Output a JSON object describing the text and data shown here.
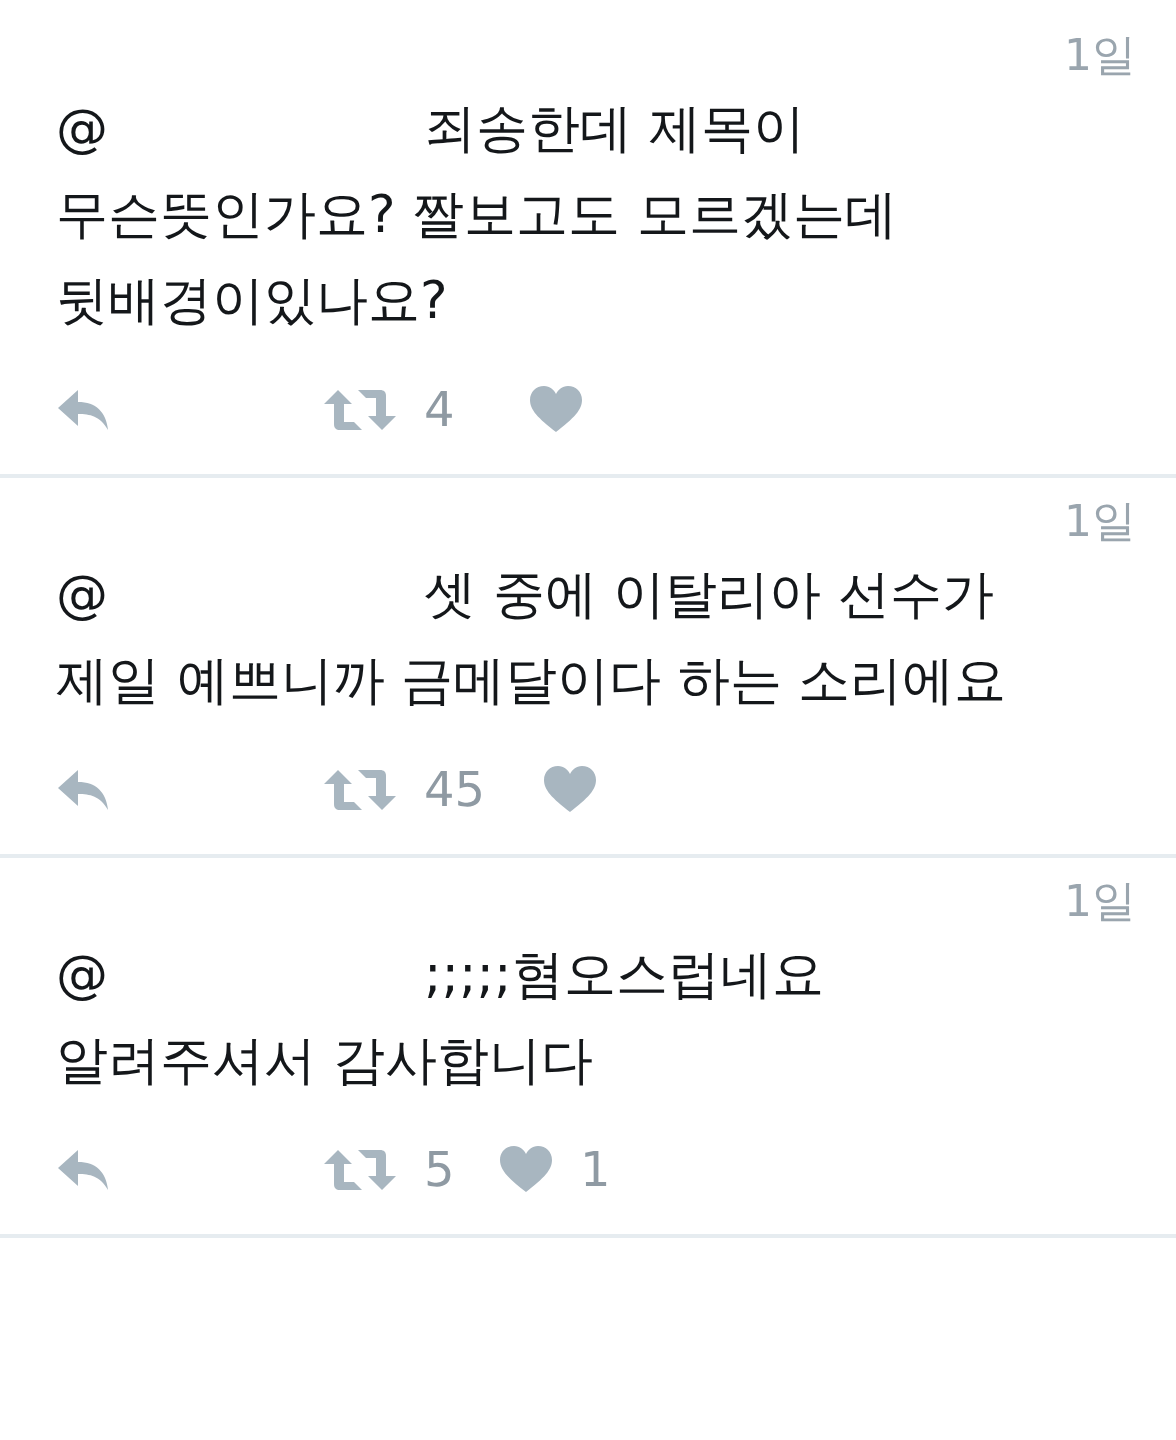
{
  "tweets": [
    {
      "time": "1일",
      "mention": "@",
      "lines": [
        "죄송한데 제목이",
        "무슨뜻인가요? 짤보고도 모르겠는데",
        "뒷배경이있나요?"
      ],
      "retweets": "4"
    },
    {
      "time": "1일",
      "mention": "@",
      "lines": [
        "셋 중에 이탈리아 선수가",
        "제일 예쁘니까 금메달이다 하는 소리에요"
      ],
      "retweets": "45"
    },
    {
      "time": "1일",
      "mention": "@",
      "lines": [
        ";;;;;혐오스럽네요",
        "알려주셔서 감사합니다"
      ],
      "retweets": "5",
      "likes": "1"
    }
  ]
}
